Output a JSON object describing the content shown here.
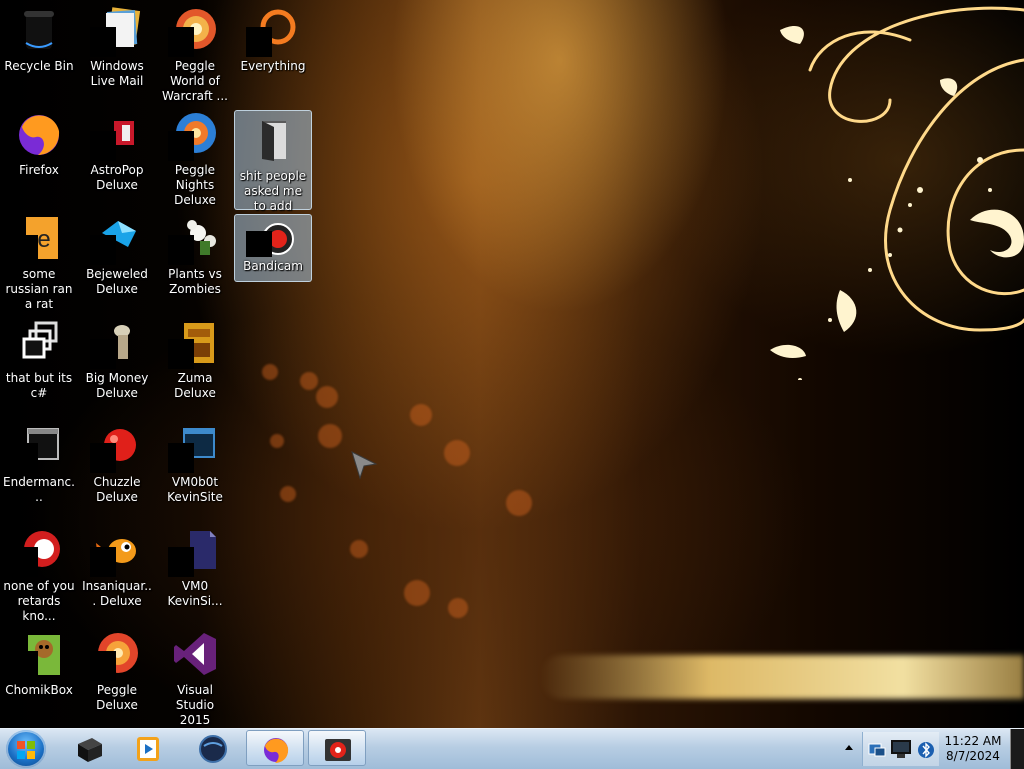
{
  "desktop": {
    "icons": [
      {
        "label": "Recycle Bin",
        "icon": "recycle-bin-icon"
      },
      {
        "label": "Windows Live Mail",
        "icon": "windows-live-mail-icon"
      },
      {
        "label": "Peggle World of Warcraft ...",
        "icon": "peggle-wow-icon"
      },
      {
        "label": "Everything",
        "icon": "everything-search-icon"
      },
      {
        "label": "Firefox",
        "icon": "firefox-icon"
      },
      {
        "label": "AstroPop Deluxe",
        "icon": "astropop-icon"
      },
      {
        "label": "Peggle Nights Deluxe",
        "icon": "peggle-nights-icon"
      },
      {
        "label": "shit people asked me to add",
        "icon": "folder-icon"
      },
      {
        "label": "some russian ran a rat",
        "icon": "document-shortcut-icon"
      },
      {
        "label": "Bejeweled Deluxe",
        "icon": "bejeweled-icon"
      },
      {
        "label": "Plants vs Zombies",
        "icon": "plants-vs-zombies-icon"
      },
      {
        "label": "Bandicam",
        "icon": "bandicam-icon"
      },
      {
        "label": "that but its c#",
        "icon": "window-stack-icon"
      },
      {
        "label": "Big Money Deluxe",
        "icon": "big-money-icon"
      },
      {
        "label": "Zuma Deluxe",
        "icon": "zuma-icon"
      },
      {
        "label": "Endermanc...",
        "icon": "endermanch-icon"
      },
      {
        "label": "Chuzzle Deluxe",
        "icon": "chuzzle-icon"
      },
      {
        "label": "VM0b0t KevinSite",
        "icon": "vm-window-icon"
      },
      {
        "label": "none of you retards kno...",
        "icon": "red-orb-icon"
      },
      {
        "label": "Insaniquar... Deluxe",
        "icon": "insaniquarium-fish-icon"
      },
      {
        "label": "VM0 KevinSi...",
        "icon": "vm-file-icon"
      },
      {
        "label": "ChomikBox",
        "icon": "chomikbox-icon"
      },
      {
        "label": "Peggle Deluxe",
        "icon": "peggle-deluxe-icon"
      },
      {
        "label": "Visual Studio 2015",
        "icon": "visual-studio-icon"
      }
    ]
  },
  "taskbar": {
    "start_icon": "windows-logo-icon",
    "tasks": [
      {
        "icon": "black-box-app-icon",
        "active": false
      },
      {
        "icon": "media-player-icon",
        "active": false
      },
      {
        "icon": "globe-app-icon",
        "active": false
      },
      {
        "icon": "firefox-icon",
        "active": true
      },
      {
        "icon": "bandicam-icon",
        "active": true
      }
    ],
    "tray_icons": [
      "network-icon",
      "monitor-icon",
      "bluetooth-icon"
    ],
    "clock_time": "11:22 AM",
    "clock_date": "8/7/2024"
  }
}
